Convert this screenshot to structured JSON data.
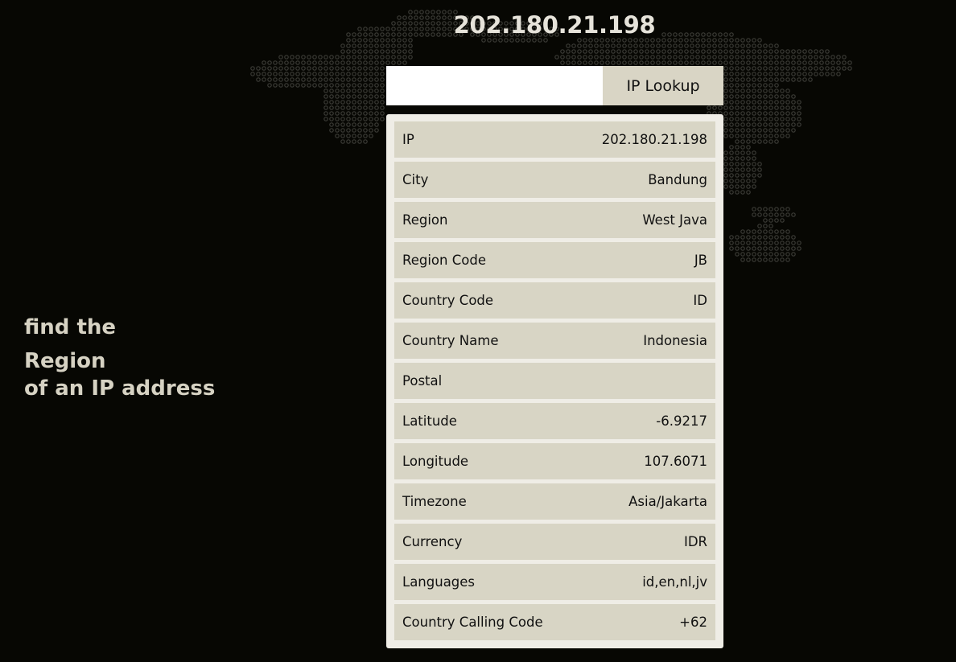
{
  "header": {
    "title": "202.180.21.198"
  },
  "search": {
    "value": "",
    "button_label": "IP Lookup"
  },
  "tagline": {
    "line1": "find the",
    "line2": "Region",
    "line3": "of an IP address"
  },
  "results": [
    {
      "label": "IP",
      "value": "202.180.21.198"
    },
    {
      "label": "City",
      "value": "Bandung"
    },
    {
      "label": "Region",
      "value": "West Java"
    },
    {
      "label": "Region Code",
      "value": "JB"
    },
    {
      "label": "Country Code",
      "value": "ID"
    },
    {
      "label": "Country Name",
      "value": "Indonesia"
    },
    {
      "label": "Postal",
      "value": ""
    },
    {
      "label": "Latitude",
      "value": "-6.9217"
    },
    {
      "label": "Longitude",
      "value": "107.6071"
    },
    {
      "label": "Timezone",
      "value": "Asia/Jakarta"
    },
    {
      "label": "Currency",
      "value": "IDR"
    },
    {
      "label": "Languages",
      "value": "id,en,nl,jv"
    },
    {
      "label": "Country Calling Code",
      "value": "+62"
    }
  ],
  "colors": {
    "background": "#070703",
    "map_dots": "#3b3b36",
    "panel": "#efede6",
    "row": "#d8d5c5",
    "button": "#d9d5c5",
    "title_text": "#e6e3da",
    "tagline_text": "#d6d2c3"
  }
}
